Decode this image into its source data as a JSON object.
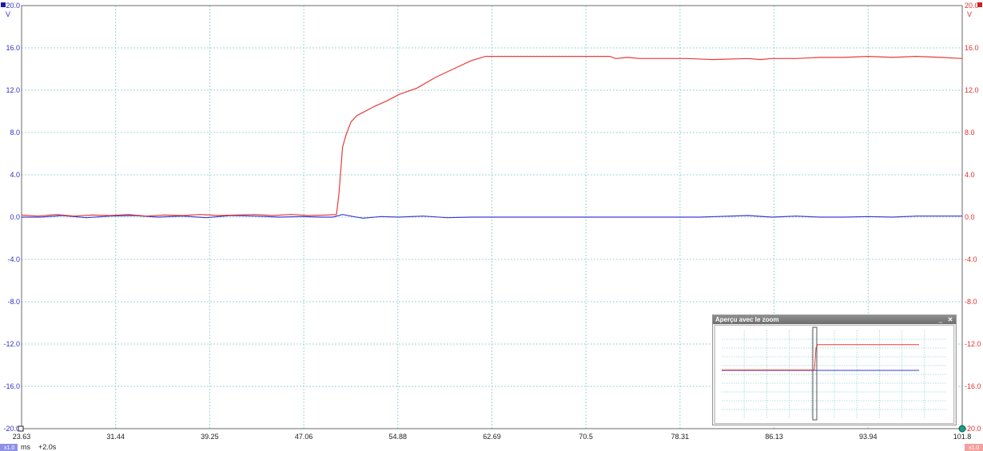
{
  "colors": {
    "channel_a": "#3a3ad6",
    "channel_b": "#ea3a3a",
    "grid": "#9fd4d4",
    "background": "#ffffff"
  },
  "axes": {
    "left_unit": "V",
    "right_unit": "V",
    "left_top_label": "20.0",
    "left_bottom_label": "-20.0",
    "right_top_label": "20.0",
    "right_bottom_label": "-20.0"
  },
  "footer": {
    "time_unit": "ms",
    "ch_a_scale_badge": "x1.0",
    "ch_b_scale_badge": "x1.0",
    "trigger_delay": "+2.0s"
  },
  "zoom_panel": {
    "title": "Aperçu avec le zoom",
    "minimize_symbol": "‗",
    "close_symbol": "✕"
  },
  "chart_data": {
    "type": "line",
    "title": "",
    "xlabel": "ms",
    "ylabel": "V",
    "xlim": [
      23.63,
      101.8
    ],
    "ylim": [
      -20.0,
      20.0
    ],
    "x_tick_labels": [
      "23.63",
      "31.44",
      "39.25",
      "47.06",
      "54.88",
      "62.69",
      "70.5",
      "78.31",
      "86.13",
      "93.94",
      "101.8"
    ],
    "y_tick_labels": [
      "20.0",
      "16.0",
      "12.0",
      "8.0",
      "4.0",
      "0.0",
      "-4.0",
      "-8.0",
      "-12.0",
      "-16.0",
      "-20.0"
    ],
    "grid": true,
    "series": [
      {
        "color": "#3a3ad6",
        "x": [
          23.63,
          25.2,
          27.0,
          29.0,
          31.0,
          33.0,
          35.0,
          37.0,
          39.0,
          41.0,
          43.0,
          45.0,
          47.0,
          48.5,
          49.5,
          50.3,
          51.2,
          52.0,
          53.5,
          55.0,
          57.0,
          59.0,
          61.0,
          63.0,
          66.0,
          70.0,
          75.0,
          80.0,
          84.0,
          86.0,
          88.0,
          90.0,
          92.0,
          94.0,
          96.0,
          98.0,
          101.8
        ],
        "values": [
          0.0,
          0.0,
          0.15,
          -0.05,
          0.1,
          0.15,
          0.0,
          0.1,
          -0.05,
          0.15,
          0.1,
          0.0,
          0.05,
          0.0,
          0.0,
          0.25,
          0.05,
          -0.1,
          0.05,
          0.0,
          0.1,
          -0.05,
          0.0,
          0.0,
          0.0,
          0.0,
          0.0,
          0.0,
          0.15,
          0.0,
          0.1,
          0.0,
          0.0,
          0.05,
          0.0,
          0.1,
          0.1
        ]
      },
      {
        "color": "#ea3a3a",
        "x": [
          23.63,
          25.0,
          26.5,
          28.0,
          29.5,
          31.0,
          32.5,
          34.0,
          35.5,
          37.0,
          38.5,
          40.0,
          41.5,
          43.0,
          44.5,
          46.0,
          47.5,
          49.0,
          49.8,
          50.0,
          50.3,
          50.6,
          51.0,
          51.5,
          52.0,
          53.0,
          54.0,
          55.0,
          56.5,
          58.0,
          59.5,
          61.0,
          62.2,
          63.0,
          66.0,
          70.0,
          72.5,
          73.0,
          74.0,
          75.0,
          77.0,
          79.0,
          81.0,
          84.0,
          85.0,
          86.0,
          88.0,
          90.0,
          92.0,
          94.0,
          96.0,
          98.0,
          100.0,
          101.8
        ],
        "values": [
          0.2,
          0.1,
          0.25,
          0.1,
          0.2,
          0.15,
          0.25,
          0.1,
          0.2,
          0.15,
          0.25,
          0.15,
          0.2,
          0.25,
          0.15,
          0.25,
          0.15,
          0.2,
          0.25,
          2.2,
          6.6,
          7.8,
          9.0,
          9.6,
          9.9,
          10.5,
          11.0,
          11.6,
          12.2,
          13.2,
          14.0,
          14.8,
          15.2,
          15.2,
          15.2,
          15.2,
          15.2,
          15.0,
          15.1,
          15.0,
          15.0,
          15.0,
          14.9,
          15.0,
          14.9,
          15.0,
          15.0,
          15.1,
          15.1,
          15.2,
          15.1,
          15.2,
          15.1,
          15.0
        ]
      }
    ]
  }
}
